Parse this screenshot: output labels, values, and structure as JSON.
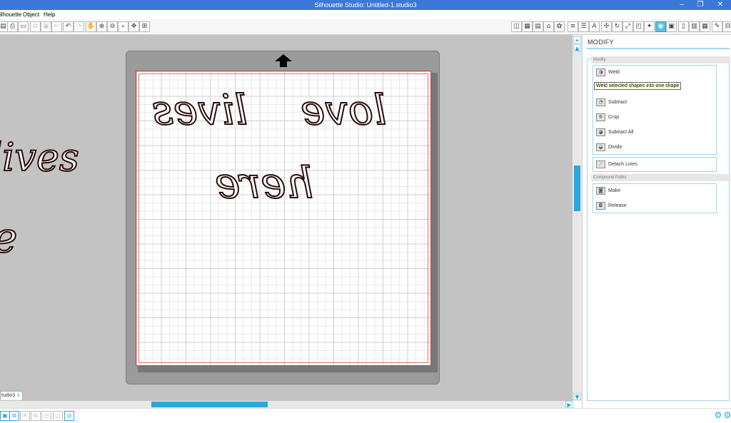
{
  "window": {
    "title": "Silhouette Studio: Untitled-1.studio3",
    "minimize": "–",
    "maximize": "❐",
    "close": "✕"
  },
  "menu": {
    "items": [
      "ilhouette",
      "Object",
      "Help"
    ]
  },
  "toolbar": {
    "left_icons": [
      "open-icon",
      "print-icon",
      "print-setup-icon",
      "copy-icon",
      "paste-icon",
      "cut-icon",
      "undo-icon",
      "redo-icon",
      "pan-icon",
      "zoom-in-icon",
      "zoom-out-icon",
      "zoom-select-icon",
      "zoom-pan-icon",
      "zoom-fit-icon"
    ],
    "right_icons": [
      "page-setup-icon",
      "grid-icon",
      "trace-icon",
      "library-icon",
      "store-icon",
      "align-icon",
      "replicate-icon",
      "text-icon",
      "transform-icon",
      "rotate-icon",
      "scale-icon",
      "offset-icon",
      "point-icon",
      "fill-icon",
      "modify-icon",
      "select-all-icon",
      "knife-icon",
      "dimensions-icon",
      "lock-icon",
      "eraser-icon",
      "paint-icon"
    ],
    "active_right": "modify-icon"
  },
  "canvas": {
    "left_text_1": "lives",
    "left_text_2": "e",
    "mat_line_1a": "love",
    "mat_line_1b": "lives",
    "mat_line_2": "here",
    "arrow": "⬆"
  },
  "document_tab": {
    "label": "tudio3",
    "close": "x"
  },
  "panel": {
    "title": "MODIFY",
    "section_modify": "Modify",
    "items": {
      "weld": "Weld",
      "tooltip": "Weld selected shapes into one shape",
      "subtract": "Subtract",
      "crop": "Crop",
      "subtract_all": "Subtract All",
      "divide": "Divide",
      "detach": "Detach Lines"
    },
    "section_compound": "Compound Paths",
    "compound": {
      "make": "Make",
      "release": "Release"
    }
  },
  "colors": {
    "accent": "#29a8dc",
    "title_bar": "#3c78d8",
    "workspace": "#c3c3c3",
    "text_stroke": "#2a0b0b"
  }
}
